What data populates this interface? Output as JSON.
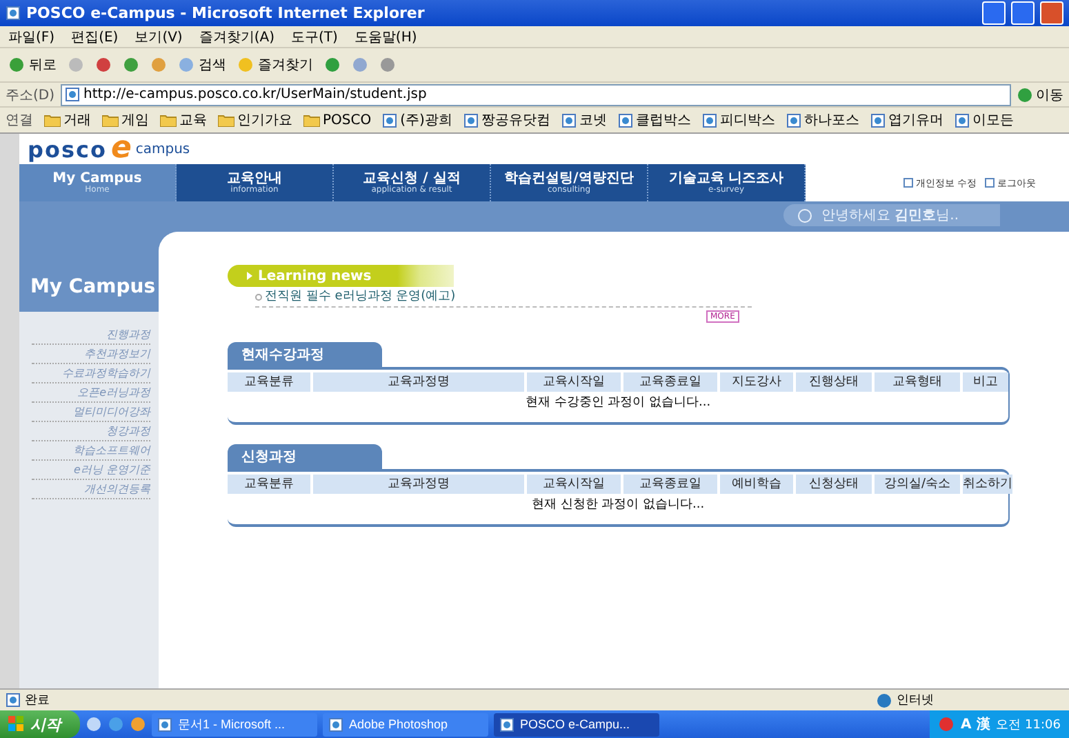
{
  "window": {
    "title": "POSCO e-Campus - Microsoft Internet Explorer"
  },
  "menu": [
    "파일(F)",
    "편집(E)",
    "보기(V)",
    "즐겨찾기(A)",
    "도구(T)",
    "도움말(H)"
  ],
  "toolbar": {
    "back": "뒤로",
    "search": "검색",
    "favorites": "즐겨찾기"
  },
  "address": {
    "label": "주소(D)",
    "url": "http://e-campus.posco.co.kr/UserMain/student.jsp",
    "go": "이동"
  },
  "links": {
    "label": "연결",
    "items": [
      {
        "kind": "folder",
        "label": "거래"
      },
      {
        "kind": "folder",
        "label": "게임"
      },
      {
        "kind": "folder",
        "label": "교육"
      },
      {
        "kind": "folder",
        "label": "인기가요"
      },
      {
        "kind": "folder",
        "label": "POSCO"
      },
      {
        "kind": "page",
        "label": "(주)광희"
      },
      {
        "kind": "page",
        "label": "짱공유닷컴"
      },
      {
        "kind": "page",
        "label": "코넷"
      },
      {
        "kind": "page",
        "label": "클럽박스"
      },
      {
        "kind": "page",
        "label": "피디박스"
      },
      {
        "kind": "page",
        "label": "하나포스"
      },
      {
        "kind": "page",
        "label": "엽기유머"
      },
      {
        "kind": "page",
        "label": "이모든"
      }
    ]
  },
  "site": {
    "logo": {
      "brand": "posco",
      "letter": "e",
      "suffix": "campus"
    },
    "nav": [
      {
        "label": "My Campus",
        "sub": "Home",
        "selected": true
      },
      {
        "label": "교육안내",
        "sub": "information",
        "selected": false
      },
      {
        "label": "교육신청 / 실적",
        "sub": "application & result",
        "selected": false
      },
      {
        "label": "학습컨설팅/역량진단",
        "sub": "consulting",
        "selected": false
      },
      {
        "label": "기술교육 니즈조사",
        "sub": "e-survey",
        "selected": false
      }
    ],
    "top_links": [
      "개인정보 수정",
      "로그아웃"
    ],
    "greeting": "안녕하세요 **김민호**님..",
    "sidebar": {
      "title": "My Campus",
      "items": [
        "진행과정",
        "추천과정보기",
        "수료과정학습하기",
        "오픈e러닝과정",
        "멀티미디어강좌",
        "청강과정",
        "학습소프트웨어",
        "e러닝 운영기준",
        "개선의견등록"
      ]
    },
    "news": {
      "title": "Learning news",
      "items": [
        "전직원 필수 e러닝과정 운영(예고)"
      ],
      "more": "MORE"
    },
    "sections": [
      {
        "title": "현재수강과정",
        "columns": [
          "교육분류",
          "교육과정명",
          "교육시작일",
          "교육종료일",
          "지도강사",
          "진행상태",
          "교육형태",
          "비고"
        ],
        "empty": "현재 수강중인 과정이 없습니다..."
      },
      {
        "title": "신청과정",
        "columns": [
          "교육분류",
          "교육과정명",
          "교육시작일",
          "교육종료일",
          "예비학습",
          "신청상태",
          "강의실/숙소",
          "취소하기"
        ],
        "empty": "현재 신청한 과정이 없습니다..."
      }
    ]
  },
  "status_bar": {
    "text": "완료",
    "zone": "인터넷"
  },
  "taskbar": {
    "start": "시작",
    "tasks": [
      {
        "label": "문서1 - Microsoft ...",
        "selected": false
      },
      {
        "label": "Adobe Photoshop",
        "selected": false
      },
      {
        "label": "POSCO e-Campu...",
        "selected": true
      }
    ],
    "tray": [
      "A",
      "漢"
    ],
    "clock": "오전 11:06"
  }
}
